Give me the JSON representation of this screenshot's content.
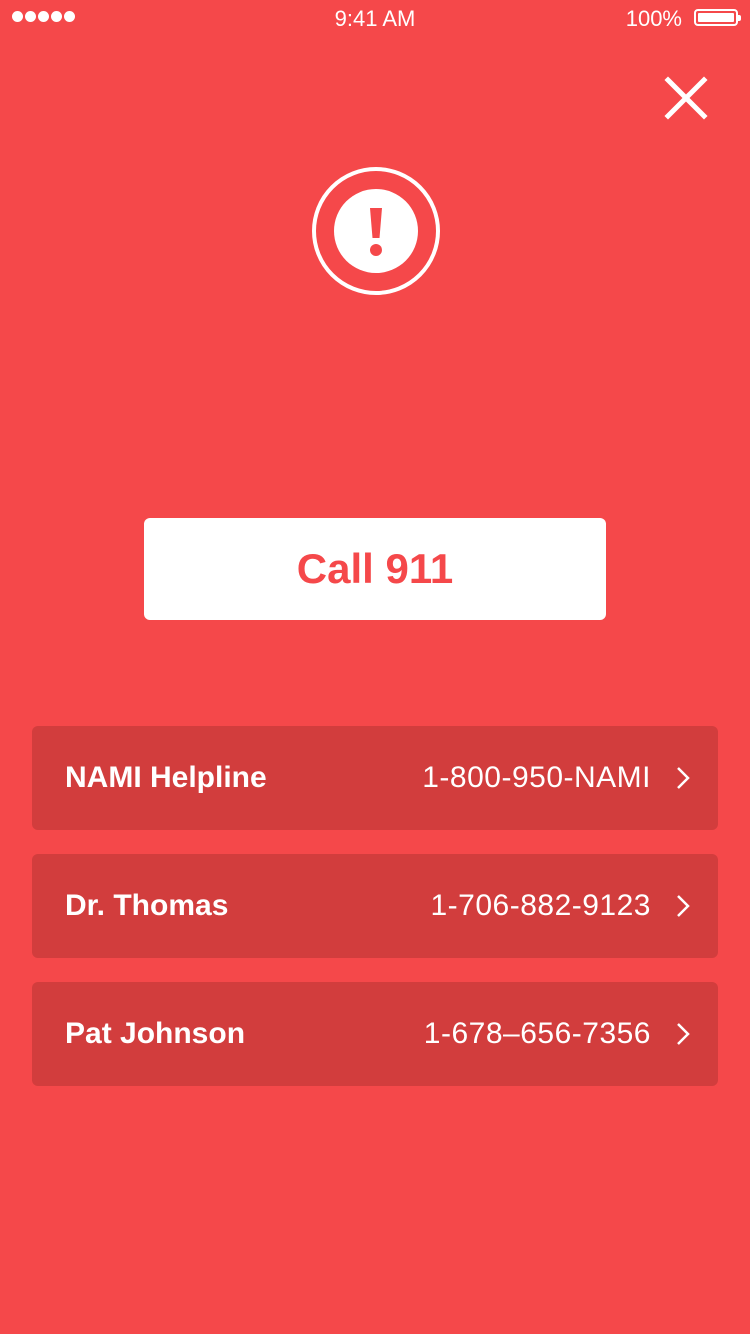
{
  "status_bar": {
    "time": "9:41 AM",
    "battery_percent": "100%",
    "battery_level": 1.0,
    "signal_dots": 5
  },
  "header": {
    "close_icon": "close-icon"
  },
  "alert": {
    "icon": "exclamation-icon"
  },
  "call_button": {
    "label": "Call 911"
  },
  "contacts": [
    {
      "name": "NAMI Helpline",
      "phone": "1-800-950-NAMI"
    },
    {
      "name": "Dr. Thomas",
      "phone": "1-706-882-9123"
    },
    {
      "name": "Pat Johnson",
      "phone": "1-678–656-7356"
    }
  ],
  "colors": {
    "background": "#F5484A",
    "row_background": "#D23D3D",
    "accent_text": "#F5484A",
    "foreground": "#FFFFFF"
  }
}
